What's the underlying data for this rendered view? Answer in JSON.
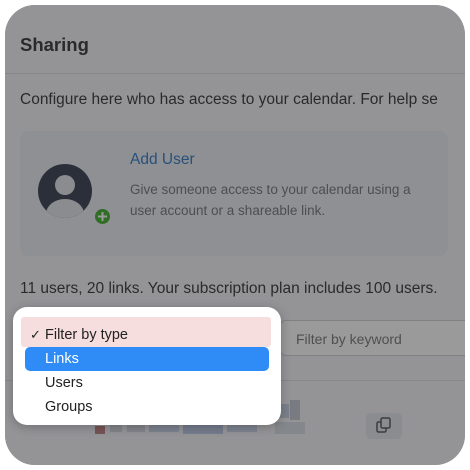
{
  "header": {
    "title": "Sharing"
  },
  "intro_text": "Configure here who has access to your calendar. For help se",
  "add_user": {
    "label": "Add User",
    "description": "Give someone access to your calendar using a user account or a shareable link.",
    "avatar_icon": "user-avatar-icon",
    "badge_icon": "plus-badge-icon"
  },
  "summary": "11 users, 20 links. Your subscription plan includes 100 users.",
  "filters": {
    "type_menu": {
      "options": [
        {
          "label": "Filter by type",
          "checked": true,
          "highlighted": false
        },
        {
          "label": "Links",
          "checked": false,
          "highlighted": true
        },
        {
          "label": "Users",
          "checked": false,
          "highlighted": false
        },
        {
          "label": "Groups",
          "checked": false,
          "highlighted": false
        }
      ],
      "check_glyph": "✓"
    },
    "keyword_placeholder": "Filter by keyword"
  },
  "row": {
    "copy_icon": "copy-icon"
  },
  "colors": {
    "link": "#2f78c3",
    "highlight": "#2f8bf6",
    "badge": "#3fae29"
  }
}
